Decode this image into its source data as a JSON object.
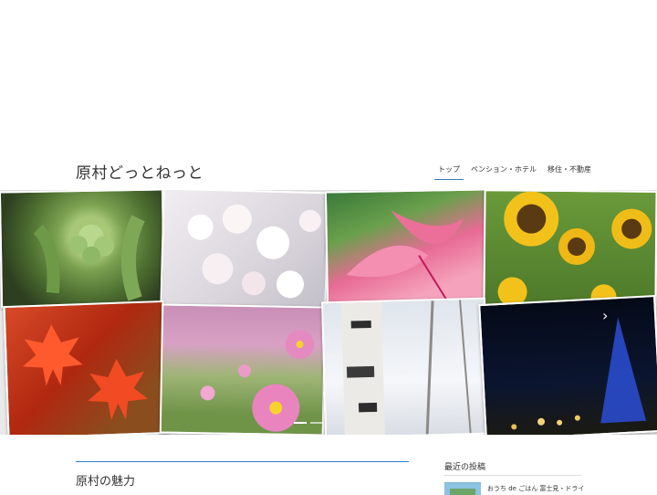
{
  "header": {
    "site_title": "原村どっとねっと",
    "nav": [
      {
        "label": "トップ",
        "active": true
      },
      {
        "label": "ペンション・ホテル",
        "active": false
      },
      {
        "label": "移住・不動産",
        "active": false
      }
    ]
  },
  "slider": {
    "photos": [
      {
        "subject": "fukinoto"
      },
      {
        "subject": "cherry-blossoms"
      },
      {
        "subject": "pink-lily"
      },
      {
        "subject": "sunflowers"
      },
      {
        "subject": "red-maple"
      },
      {
        "subject": "cosmos-field"
      },
      {
        "subject": "birch-snow"
      },
      {
        "subject": "night-illumination"
      }
    ],
    "next_arrow": "›",
    "dot_count": 2,
    "active_dot": 0
  },
  "main": {
    "section_title": "原村の魅力"
  },
  "sidebar": {
    "recent_title": "最近の投稿",
    "posts": [
      {
        "title": "おうち de ごはん 富士見・ドライ"
      }
    ]
  },
  "colors": {
    "accent": "#2f7fc4"
  }
}
